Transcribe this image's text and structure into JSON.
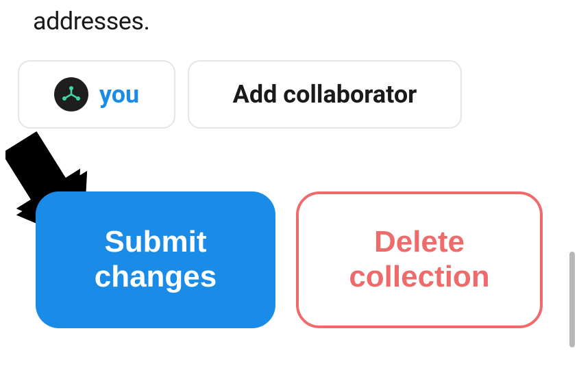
{
  "partial_text": "addresses.",
  "collaborators": {
    "you_label": "you"
  },
  "add_collaborator_label": "Add collaborator",
  "actions": {
    "submit_label": "Submit changes",
    "delete_label": "Delete collection"
  },
  "colors": {
    "primary_blue": "#1a8ce8",
    "danger_red": "#ef6b6b"
  }
}
